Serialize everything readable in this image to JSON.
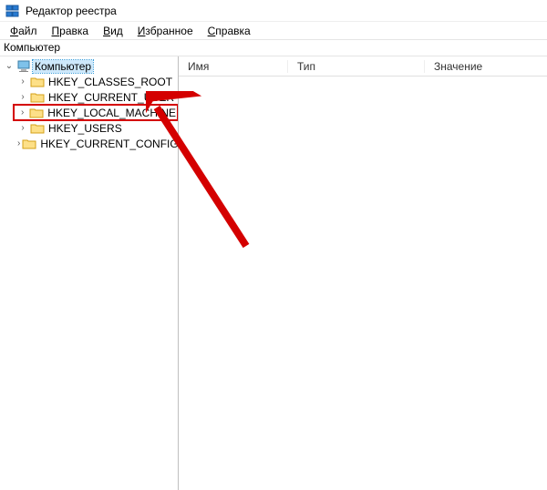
{
  "title": "Редактор реестра",
  "menu": {
    "file": "Файл",
    "edit": "Правка",
    "view": "Вид",
    "favorites": "Избранное",
    "help": "Справка"
  },
  "menu_accel": {
    "file": "Ф",
    "edit": "П",
    "view": "В",
    "favorites": "И",
    "help": "С"
  },
  "pathbar": "Компьютер",
  "tree": {
    "root": "Компьютер",
    "items": [
      {
        "label": "HKEY_CLASSES_ROOT"
      },
      {
        "label": "HKEY_CURRENT_USER"
      },
      {
        "label": "HKEY_LOCAL_MACHINE"
      },
      {
        "label": "HKEY_USERS"
      },
      {
        "label": "HKEY_CURRENT_CONFIG"
      }
    ]
  },
  "columns": {
    "name": "Имя",
    "type": "Тип",
    "value": "Значение"
  },
  "highlight_index": 2
}
